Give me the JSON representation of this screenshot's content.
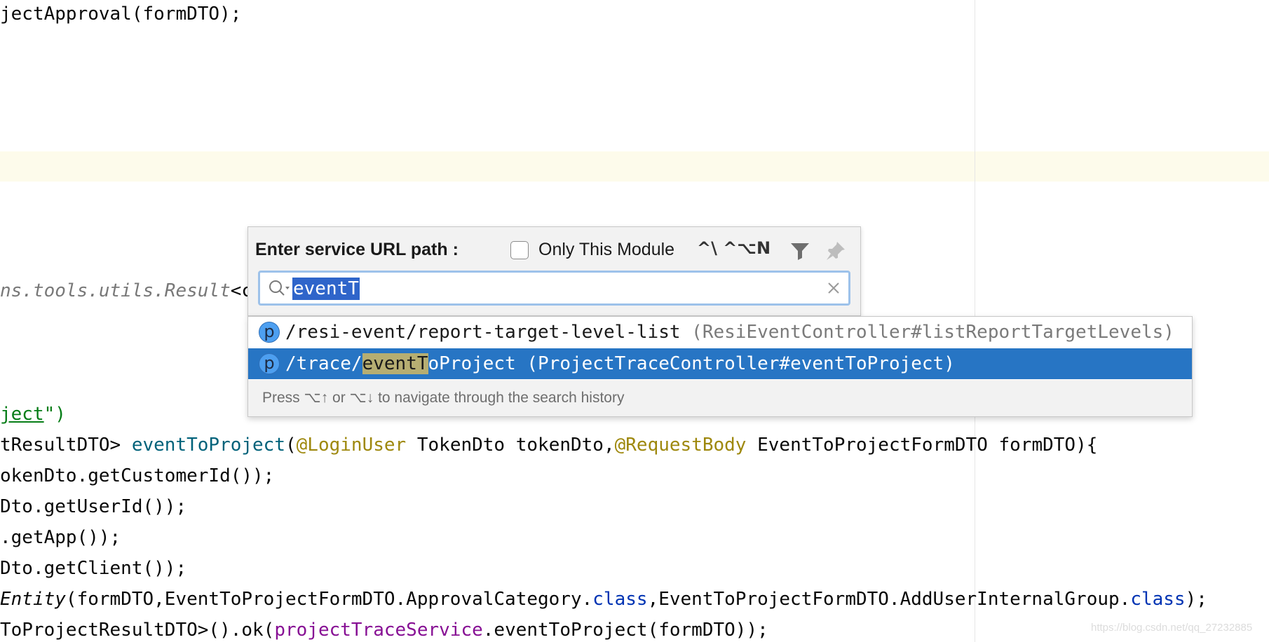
{
  "code": {
    "line1": "jectApproval(formDTO);",
    "line_comment": {
      "text": "ns.tools.utils.Result",
      "tail": "<c"
    },
    "line_string": {
      "link": "ject",
      "rest": "\")"
    },
    "line_method": {
      "prefix": "tResultDTO> ",
      "func": "eventToProject",
      "paren": "(",
      "ann1": "@LoginUser",
      "mid1": " TokenDto tokenDto,",
      "ann2": "@RequestBody",
      "rest": " EventToProjectFormDTO formDTO){"
    },
    "line_a": "okenDto.getCustomerId());",
    "line_b": "Dto.getUserId());",
    "line_c": ".getApp());",
    "line_d": "Dto.getClient());",
    "line_e": {
      "italic": "Entity",
      "p1": "(formDTO,EventToProjectFormDTO.ApprovalCategory.",
      "kw1": "class",
      "p2": ",EventToProjectFormDTO.AddUserInternalGroup.",
      "kw2": "class",
      "p3": ");"
    },
    "line_f": {
      "prefix": "ToProjectResultDTO>().ok(",
      "field": "projectTraceService",
      "rest": ".eventToProject(formDTO));"
    }
  },
  "popup": {
    "title": "Enter service URL path :",
    "checkbox_label": "Only This Module",
    "checkbox_checked": false,
    "shortcut": "^\\ ^⌥N",
    "search_value": "eventT",
    "results": [
      {
        "icon_letter": "p",
        "path": "/resi-event/report-target-level-list",
        "context": " (ResiEventController#listReportTargetLevels)",
        "selected": false
      },
      {
        "icon_letter": "p",
        "path_before": "/trace/",
        "path_match": "eventT",
        "path_after": "oProject",
        "context": " (ProjectTraceController#eventToProject)",
        "selected": true
      }
    ],
    "hint": "Press ⌥↑ or ⌥↓ to navigate through the search history"
  },
  "watermark": "https://blog.csdn.net/qq_27232885",
  "colors": {
    "selection": "#2775c4",
    "match_highlight": "#b6ae72",
    "annotation": "#9e880d",
    "keyword": "#0033b3",
    "field": "#871094"
  }
}
